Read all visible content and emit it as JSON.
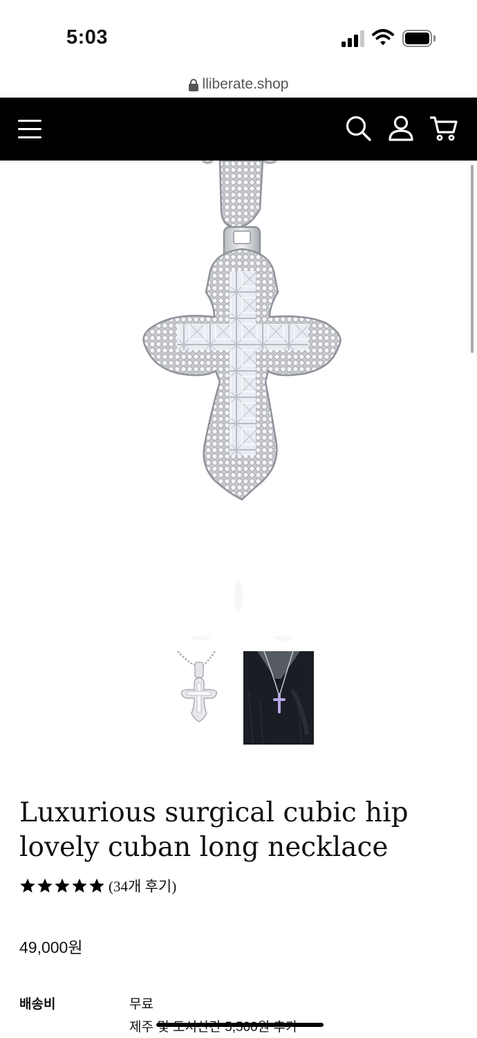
{
  "status_bar": {
    "time": "5:03"
  },
  "browser": {
    "url": "lliberate.shop"
  },
  "header": {
    "icons": [
      "menu-icon",
      "search-icon",
      "user-icon",
      "cart-icon"
    ],
    "background": "#000000"
  },
  "product": {
    "images": [
      "cross-pendant-front",
      "cross-pendant-worn"
    ],
    "title": "Luxurious surgical cubic hip lovely cuban long necklace",
    "rating": 5,
    "review_count_label": "(34개 후기)",
    "price": "49,000원",
    "shipping": {
      "label": "배송비",
      "value": "무료",
      "note": "제주 및 도서산간 5,500원 추가"
    }
  }
}
